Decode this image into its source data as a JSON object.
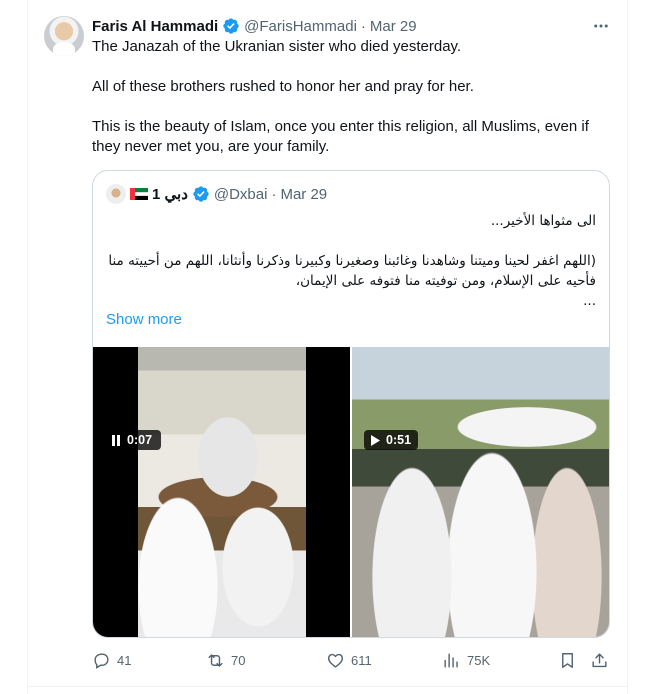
{
  "tweet": {
    "author_name": "Faris Al Hammadi",
    "handle": "@FarisHammadi",
    "separator": "·",
    "date": "Mar 29",
    "avatar_icon": "profile-photo",
    "text_lines": [
      "The Janazah of the Ukranian sister who died yesterday.",
      "All of these brothers rushed to honor her and pray for her.",
      "This is the beauty of Islam, once you enter this religion, all Muslims, even if they never met you, are your family."
    ]
  },
  "quote": {
    "author_name": "دبي 1",
    "handle": "@Dxbai",
    "separator": "·",
    "date": "Mar 29",
    "text_line1": "الى مثواها الأخير...",
    "text_line2": "(اللهم اغفر لحينا وميتنا وشاهدنا وغائبنا وصغيرنا وكبيرنا وذكرنا وأنثانا، اللهم من أحييته منا فأحيه على الإسلام، ومن توفيته منا فتوفه على الإيمان،",
    "text_line3": "...",
    "show_more": "Show more",
    "media": [
      {
        "duration": "0:07",
        "state": "pause-icon"
      },
      {
        "duration": "0:51",
        "state": "play-icon"
      }
    ]
  },
  "actions": {
    "replies": "41",
    "reposts": "70",
    "likes": "611",
    "views": "75K"
  },
  "colors": {
    "accent": "#1d9bf0",
    "text": "#0f1419",
    "muted": "#536471",
    "border": "#cfd9de",
    "flag_red": "#ef3340",
    "flag_green": "#00843d",
    "flag_black": "#000000"
  }
}
